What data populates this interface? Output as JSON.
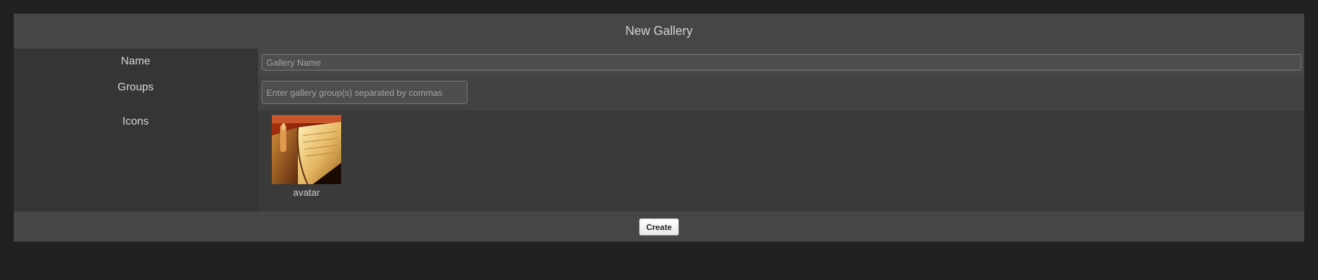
{
  "form": {
    "title": "New Gallery",
    "name": {
      "label": "Name",
      "value": "",
      "placeholder": "Gallery Name"
    },
    "groups": {
      "label": "Groups",
      "value": "",
      "placeholder": "Enter gallery group(s) separated by commas"
    },
    "icons": {
      "label": "Icons",
      "items": [
        {
          "caption": "avatar",
          "image": "open-book-photo"
        }
      ]
    },
    "create_label": "Create"
  }
}
